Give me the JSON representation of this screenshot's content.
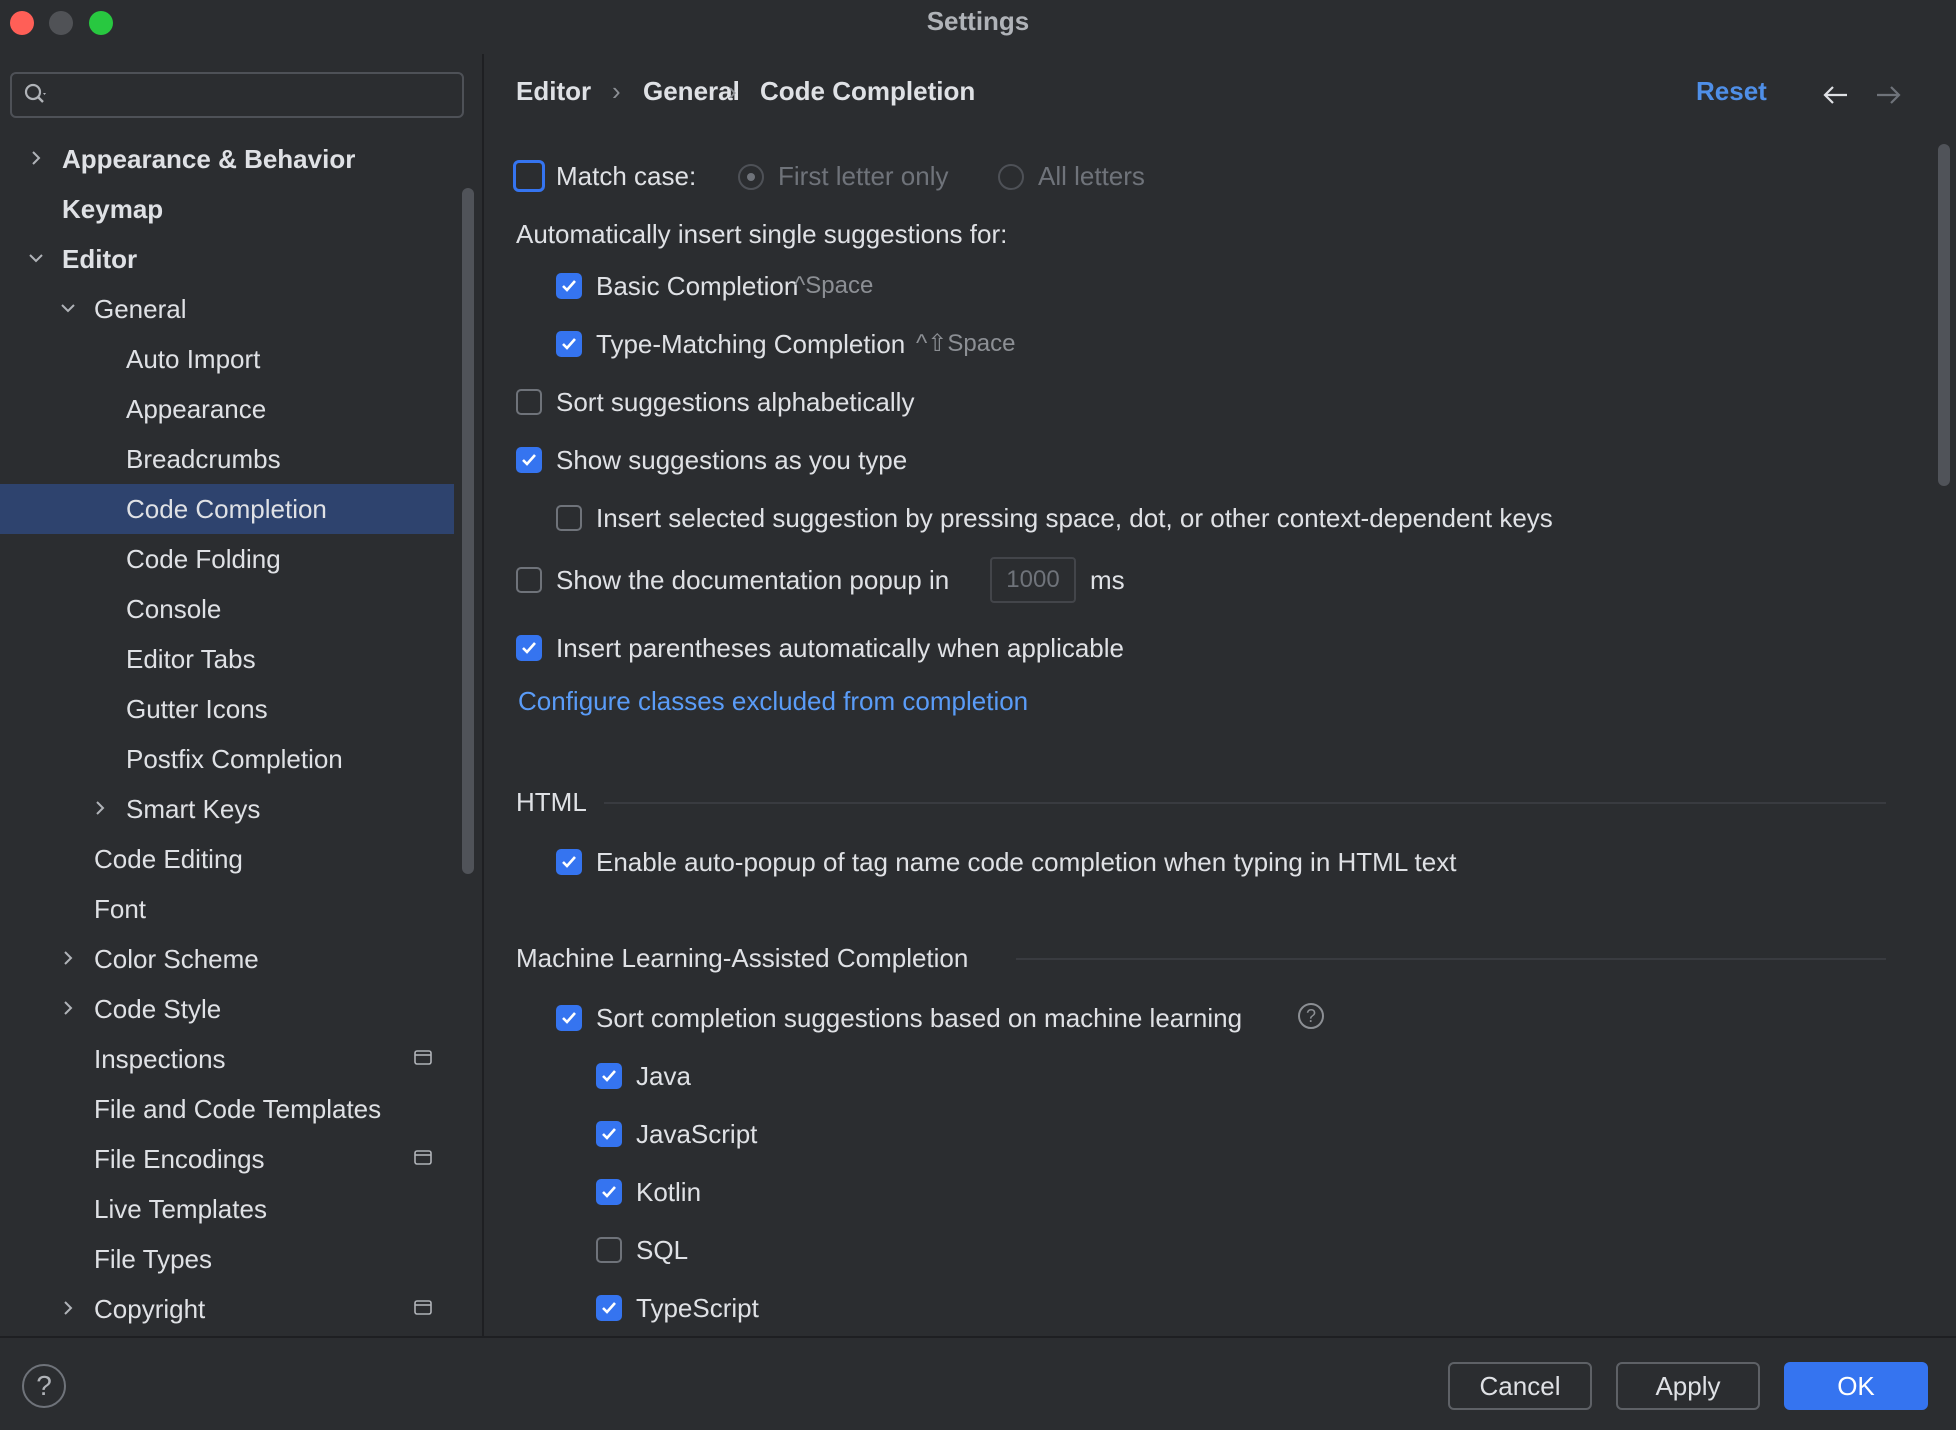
{
  "window": {
    "title": "Settings"
  },
  "search": {
    "value": "",
    "placeholder": ""
  },
  "tree": [
    {
      "label": "Appearance & Behavior",
      "bold": true,
      "arrow": "right",
      "indent": 0
    },
    {
      "label": "Keymap",
      "bold": true,
      "arrow": "none",
      "indent": 0
    },
    {
      "label": "Editor",
      "bold": true,
      "arrow": "down",
      "indent": 0
    },
    {
      "label": "General",
      "bold": false,
      "arrow": "down",
      "indent": 1
    },
    {
      "label": "Auto Import",
      "bold": false,
      "arrow": "none",
      "indent": 2
    },
    {
      "label": "Appearance",
      "bold": false,
      "arrow": "none",
      "indent": 2
    },
    {
      "label": "Breadcrumbs",
      "bold": false,
      "arrow": "none",
      "indent": 2
    },
    {
      "label": "Code Completion",
      "bold": false,
      "arrow": "none",
      "indent": 2,
      "selected": true
    },
    {
      "label": "Code Folding",
      "bold": false,
      "arrow": "none",
      "indent": 2
    },
    {
      "label": "Console",
      "bold": false,
      "arrow": "none",
      "indent": 2
    },
    {
      "label": "Editor Tabs",
      "bold": false,
      "arrow": "none",
      "indent": 2
    },
    {
      "label": "Gutter Icons",
      "bold": false,
      "arrow": "none",
      "indent": 2
    },
    {
      "label": "Postfix Completion",
      "bold": false,
      "arrow": "none",
      "indent": 2
    },
    {
      "label": "Smart Keys",
      "bold": false,
      "arrow": "right",
      "indent": 2
    },
    {
      "label": "Code Editing",
      "bold": false,
      "arrow": "none",
      "indent": 1
    },
    {
      "label": "Font",
      "bold": false,
      "arrow": "none",
      "indent": 1
    },
    {
      "label": "Color Scheme",
      "bold": false,
      "arrow": "right",
      "indent": 1
    },
    {
      "label": "Code Style",
      "bold": false,
      "arrow": "right",
      "indent": 1
    },
    {
      "label": "Inspections",
      "bold": false,
      "arrow": "none",
      "indent": 1,
      "badge": true
    },
    {
      "label": "File and Code Templates",
      "bold": false,
      "arrow": "none",
      "indent": 1
    },
    {
      "label": "File Encodings",
      "bold": false,
      "arrow": "none",
      "indent": 1,
      "badge": true
    },
    {
      "label": "Live Templates",
      "bold": false,
      "arrow": "none",
      "indent": 1
    },
    {
      "label": "File Types",
      "bold": false,
      "arrow": "none",
      "indent": 1
    },
    {
      "label": "Copyright",
      "bold": false,
      "arrow": "right",
      "indent": 1,
      "badge": true
    }
  ],
  "breadcrumb": {
    "items": [
      "Editor",
      "General",
      "Code Completion"
    ],
    "separator": "›"
  },
  "reset_label": "Reset",
  "content": {
    "match_case": {
      "label": "Match case:",
      "checked": false,
      "radio_first": "First letter only",
      "radio_all": "All letters"
    },
    "auto_insert_heading": "Automatically insert single suggestions for:",
    "basic_completion": {
      "label": "Basic Completion",
      "shortcut": "^Space",
      "checked": true
    },
    "type_matching": {
      "label": "Type-Matching Completion",
      "shortcut": "^⇧Space",
      "checked": true
    },
    "sort_alpha": {
      "label": "Sort suggestions alphabetically",
      "checked": false
    },
    "show_as_type": {
      "label": "Show suggestions as you type",
      "checked": true
    },
    "insert_selected": {
      "label": "Insert selected suggestion by pressing space, dot, or other context-dependent keys",
      "checked": false
    },
    "doc_popup": {
      "label": "Show the documentation popup in",
      "value": "1000",
      "unit": "ms",
      "checked": false
    },
    "insert_parens": {
      "label": "Insert parentheses automatically when applicable",
      "checked": true
    },
    "configure_link": "Configure classes excluded from completion",
    "html_section": "HTML",
    "html_autopopup": {
      "label": "Enable auto-popup of tag name code completion when typing in HTML text",
      "checked": true
    },
    "ml_section": "Machine Learning-Assisted Completion",
    "ml_sort": {
      "label": "Sort completion suggestions based on machine learning",
      "checked": true
    },
    "languages": [
      {
        "label": "Java",
        "checked": true
      },
      {
        "label": "JavaScript",
        "checked": true
      },
      {
        "label": "Kotlin",
        "checked": true
      },
      {
        "label": "SQL",
        "checked": false
      },
      {
        "label": "TypeScript",
        "checked": true
      }
    ]
  },
  "footer": {
    "help": "?",
    "cancel": "Cancel",
    "apply": "Apply",
    "ok": "OK"
  },
  "colors": {
    "accent": "#3574f0",
    "link": "#5a9cf8",
    "selection": "#2e436e",
    "background": "#2b2d30"
  }
}
